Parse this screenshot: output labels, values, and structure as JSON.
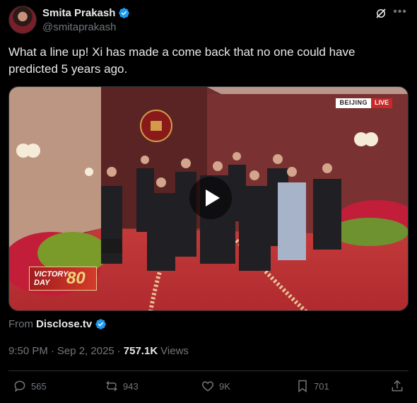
{
  "author": {
    "display_name": "Smita Prakash",
    "handle": "@smitaprakash"
  },
  "tweet": {
    "text": "What a line up! Xi has made a come back that no one could have predicted 5 years ago."
  },
  "media": {
    "type": "video",
    "overlay_city": "BEIJING",
    "overlay_live": "LIVE",
    "overlay_victory_text": "VICTORY DAY",
    "overlay_victory_number": "80"
  },
  "source": {
    "prefix": "From",
    "name": "Disclose.tv"
  },
  "meta": {
    "time": "9:50 PM",
    "separator": "·",
    "date": "Sep 2, 2025",
    "separator2": "·",
    "views_count": "757.1K",
    "views_label": "Views"
  },
  "actions": {
    "replies": "565",
    "reposts": "943",
    "likes": "9K",
    "bookmarks": "701"
  },
  "icons": {
    "verified": "verified-badge-icon",
    "grok": "grok-icon",
    "more": "more-icon",
    "reply": "reply-icon",
    "repost": "repost-icon",
    "like": "heart-icon",
    "bookmark": "bookmark-icon",
    "share": "share-icon"
  },
  "colors": {
    "verified_blue": "#1d9bf0",
    "text_primary": "#e7e9ea",
    "text_secondary": "#71767b",
    "background": "#000000"
  }
}
